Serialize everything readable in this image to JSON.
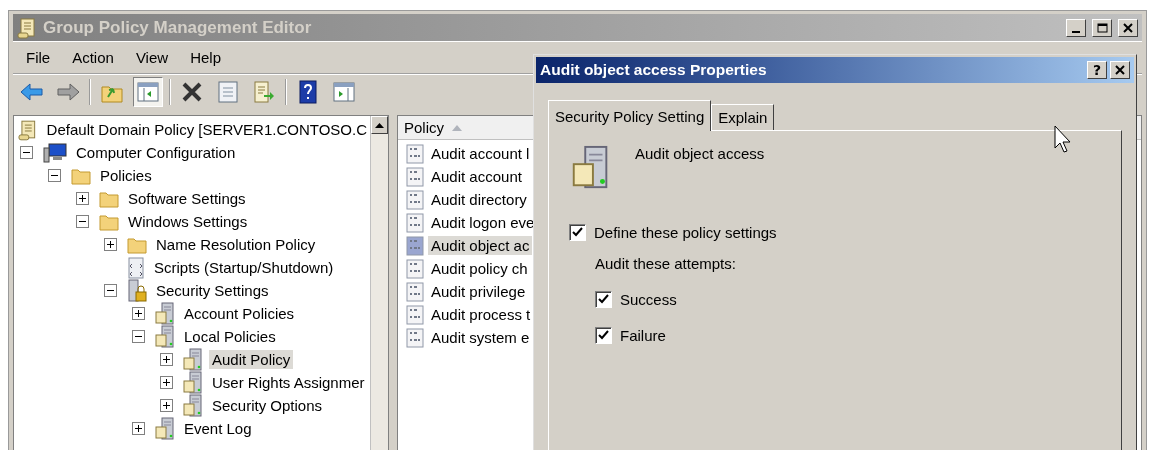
{
  "window": {
    "title": "Group Policy Management Editor",
    "active": false
  },
  "menu": [
    "File",
    "Action",
    "View",
    "Help"
  ],
  "toolbar": [
    {
      "kind": "back",
      "pressed": false
    },
    {
      "kind": "forward",
      "pressed": false
    },
    {
      "kind": "separator"
    },
    {
      "kind": "up",
      "pressed": false
    },
    {
      "kind": "tree",
      "pressed": true
    },
    {
      "kind": "separator"
    },
    {
      "kind": "delete",
      "pressed": false
    },
    {
      "kind": "properties",
      "pressed": false
    },
    {
      "kind": "export",
      "pressed": false
    },
    {
      "kind": "separator"
    },
    {
      "kind": "help",
      "pressed": false
    },
    {
      "kind": "action",
      "pressed": false
    }
  ],
  "tree": {
    "items": [
      {
        "label": "Default Domain Policy [SERVER1.CONTOSO.C",
        "kind": "scroll",
        "selected": false,
        "children": [
          {
            "label": "Computer Configuration",
            "kind": "computer",
            "expanded": true,
            "selected": false,
            "children": [
              {
                "label": "Policies",
                "kind": "folder",
                "expanded": true,
                "selected": false,
                "children": [
                  {
                    "label": "Software Settings",
                    "kind": "folder",
                    "expanded": false,
                    "selected": false
                  },
                  {
                    "label": "Windows Settings",
                    "kind": "folder",
                    "expanded": true,
                    "selected": false,
                    "children": [
                      {
                        "label": "Name Resolution Policy",
                        "kind": "folder",
                        "expanded": false,
                        "selected": false
                      },
                      {
                        "label": "Scripts (Startup/Shutdown)",
                        "kind": "script",
                        "selected": false
                      },
                      {
                        "label": "Security Settings",
                        "kind": "security",
                        "expanded": true,
                        "selected": false,
                        "children": [
                          {
                            "label": "Account Policies",
                            "kind": "server",
                            "expanded": false,
                            "selected": false
                          },
                          {
                            "label": "Local Policies",
                            "kind": "server",
                            "expanded": true,
                            "selected": false,
                            "children": [
                              {
                                "label": "Audit Policy",
                                "kind": "server",
                                "expanded": false,
                                "selected": true
                              },
                              {
                                "label": "User Rights Assignmer",
                                "kind": "server",
                                "expanded": false,
                                "selected": false
                              },
                              {
                                "label": "Security Options",
                                "kind": "server",
                                "expanded": false,
                                "selected": false
                              }
                            ]
                          },
                          {
                            "label": "Event Log",
                            "kind": "server",
                            "expanded": false,
                            "selected": false
                          }
                        ]
                      }
                    ]
                  }
                ]
              }
            ]
          }
        ]
      }
    ]
  },
  "list": {
    "columns": [
      {
        "label": "Policy"
      }
    ],
    "rows": [
      {
        "label": "Audit account l",
        "selected": false
      },
      {
        "label": "Audit account",
        "selected": false
      },
      {
        "label": "Audit directory",
        "selected": false
      },
      {
        "label": "Audit logon eve",
        "selected": false
      },
      {
        "label": "Audit object ac",
        "selected": true
      },
      {
        "label": "Audit policy ch",
        "selected": false
      },
      {
        "label": "Audit privilege",
        "selected": false
      },
      {
        "label": "Audit process t",
        "selected": false
      },
      {
        "label": "Audit system e",
        "selected": false
      }
    ]
  },
  "dialog": {
    "title": "Audit object access Properties",
    "help_button": "?",
    "tabs": [
      {
        "label": "Security Policy Setting",
        "selected": true
      },
      {
        "label": "Explain",
        "selected": false
      }
    ],
    "policy_name": "Audit object access",
    "define": {
      "label": "Define these policy settings",
      "checked": true
    },
    "attempts_label": "Audit these attempts:",
    "attempts": [
      {
        "label": "Success",
        "checked": true
      },
      {
        "label": "Failure",
        "checked": true
      }
    ]
  }
}
